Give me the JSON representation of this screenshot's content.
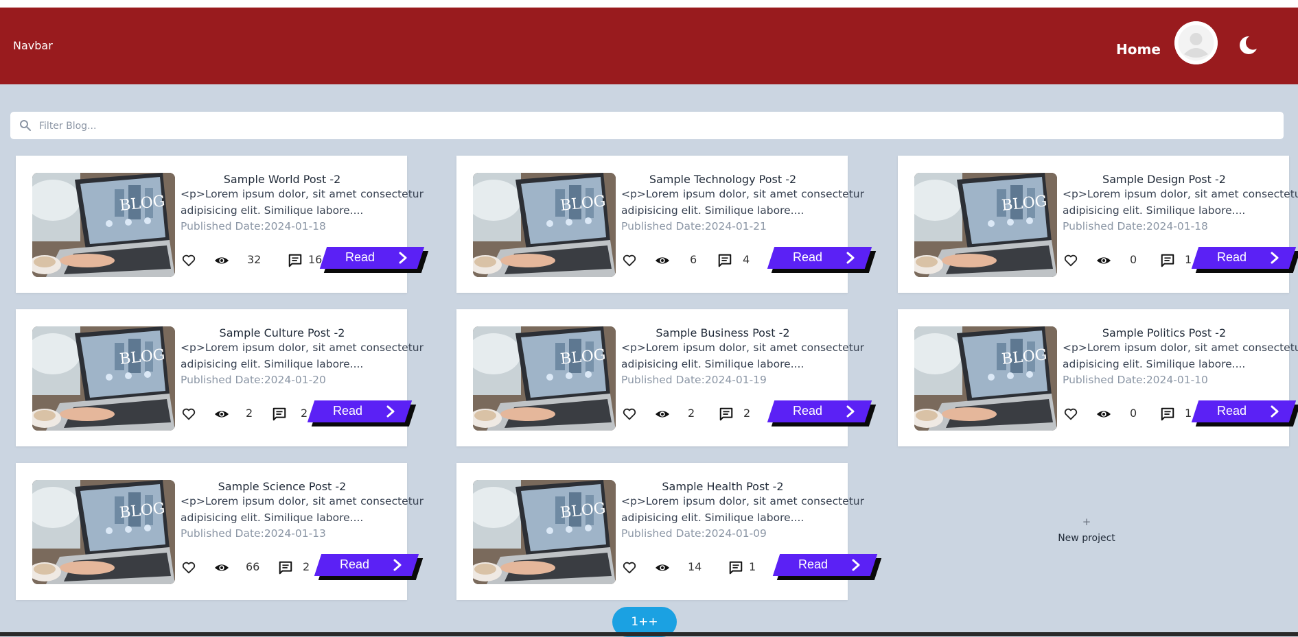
{
  "navbar": {
    "brand": "Navbar",
    "home_label": "Home",
    "bg_color": "#991b1e"
  },
  "search": {
    "placeholder": "Filter Blog..."
  },
  "posts": [
    {
      "title": "Sample World Post -2",
      "excerpt": "<p>Lorem ipsum dolor, sit amet consectetur adipisicing elit. Similique labore....",
      "date": "Published Date:2024-01-18",
      "views": "32",
      "comments": "16",
      "read_label": "Read"
    },
    {
      "title": "Sample Technology Post -2",
      "excerpt": "<p>Lorem ipsum dolor, sit amet consectetur adipisicing elit. Similique labore....",
      "date": "Published Date:2024-01-21",
      "views": "6",
      "comments": "4",
      "read_label": "Read"
    },
    {
      "title": "Sample Design Post -2",
      "excerpt": "<p>Lorem ipsum dolor, sit amet consectetur adipisicing elit. Similique labore....",
      "date": "Published Date:2024-01-18",
      "views": "0",
      "comments": "1",
      "read_label": "Read"
    },
    {
      "title": "Sample Culture Post -2",
      "excerpt": "<p>Lorem ipsum dolor, sit amet consectetur adipisicing elit. Similique labore....",
      "date": "Published Date:2024-01-20",
      "views": "2",
      "comments": "2",
      "read_label": "Read"
    },
    {
      "title": "Sample Business Post -2",
      "excerpt": "<p>Lorem ipsum dolor, sit amet consectetur adipisicing elit. Similique labore....",
      "date": "Published Date:2024-01-19",
      "views": "2",
      "comments": "2",
      "read_label": "Read"
    },
    {
      "title": "Sample Politics Post -2",
      "excerpt": "<p>Lorem ipsum dolor, sit amet consectetur adipisicing elit. Similique labore....",
      "date": "Published Date:2024-01-10",
      "views": "0",
      "comments": "1",
      "read_label": "Read"
    },
    {
      "title": "Sample Science Post -2",
      "excerpt": "<p>Lorem ipsum dolor, sit amet consectetur adipisicing elit. Similique labore....",
      "date": "Published Date:2024-01-13",
      "views": "66",
      "comments": "2",
      "read_label": "Read"
    },
    {
      "title": "Sample Health Post -2",
      "excerpt": "<p>Lorem ipsum dolor, sit amet consectetur adipisicing elit. Similique labore....",
      "date": "Published Date:2024-01-09",
      "views": "14",
      "comments": "1",
      "read_label": "Read"
    }
  ],
  "new_project": {
    "plus": "+",
    "label": "New project"
  },
  "pagination": {
    "label": "1++"
  },
  "colors": {
    "page_bg": "#cbd5e1",
    "read_button": "#5b21f5",
    "pager": "#1ba1e2"
  },
  "icons": [
    "heart-icon",
    "eye-icon",
    "comment-icon",
    "chevron-right-icon",
    "search-icon",
    "moon-icon",
    "avatar-icon"
  ]
}
